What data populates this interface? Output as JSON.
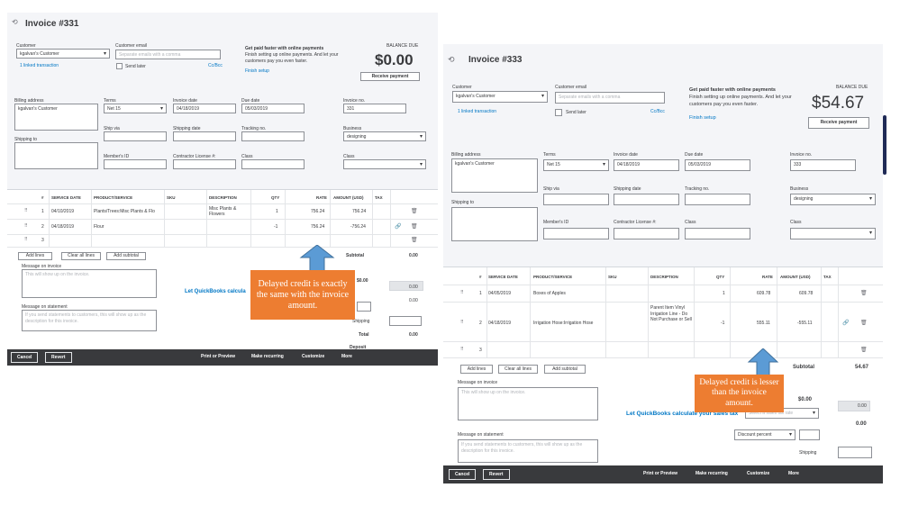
{
  "colors": {
    "callout": "#ed7d31",
    "arrow": "#5b9bd5",
    "link": "#0077c5",
    "footer": "#393a3d"
  },
  "left": {
    "title": "Invoice #331",
    "customer_label": "Customer",
    "customer_value": "kgalvan's Customer",
    "linked_transaction": "1 linked transaction",
    "email_label": "Customer email",
    "email_placeholder": "Separate emails with a comma",
    "send_later": "Send later",
    "cc_bcc": "Cc/Bcc",
    "online_title": "Get paid faster with online payments",
    "online_text": "Finish setting up online payments. And let your customers pay you even faster.",
    "finish_setup": "Finish setup",
    "balance_label": "BALANCE DUE",
    "balance_value": "$0.00",
    "receive_payment": "Receive payment",
    "billing_label": "Billing address",
    "billing_value": "kgalvan's Customer",
    "shipping_label": "Shipping to",
    "terms_label": "Terms",
    "terms_value": "Net 15",
    "invoice_date_label": "Invoice date",
    "invoice_date_value": "04/18/2019",
    "due_date_label": "Due date",
    "due_date_value": "05/03/2019",
    "invoice_no_label": "Invoice no.",
    "invoice_no_value": "331",
    "ship_via_label": "Ship via",
    "shipping_date_label": "Shipping date",
    "tracking_label": "Tracking no.",
    "business_label": "Business",
    "business_value": "designing",
    "members_label": "Member's ID",
    "contractor_label": "Contractor License #:",
    "class_label": "Class",
    "class2_label": "Class",
    "headers": [
      "#",
      "SERVICE DATE",
      "PRODUCT/SERVICE",
      "SKU",
      "DESCRIPTION",
      "QTY",
      "RATE",
      "AMOUNT (USD)",
      "TAX"
    ],
    "rows": [
      {
        "num": "1",
        "date": "04/10/2019",
        "product": "Plants/Trees:Misc Plants & Flo",
        "desc": "Misc Plants & Flowers",
        "qty": "1",
        "rate": "756.24",
        "amount": "756.24"
      },
      {
        "num": "2",
        "date": "04/18/2019",
        "product": "Flour",
        "desc": "",
        "qty": "-1",
        "rate": "756.24",
        "amount": "-756.24"
      },
      {
        "num": "3",
        "date": "",
        "product": "",
        "desc": "",
        "qty": "",
        "rate": "",
        "amount": ""
      }
    ],
    "add_lines": "Add lines",
    "clear_lines": "Clear all lines",
    "add_subtotal": "Add subtotal",
    "subtotal_label": "Subtotal",
    "subtotal_value": "0.00",
    "message_invoice_label": "Message on invoice",
    "message_invoice_placeholder": "This will show up on the invoice.",
    "message_statement_label": "Message on statement",
    "message_statement_placeholder": "If you send statements to customers, this will show up as the description for this invoice.",
    "quickbooks_link": "Let QuickBooks calcula",
    "tax_value": "$0.00",
    "tax_value2": "0.00",
    "tax_value3": "0.00",
    "shipping_label2": "Shipping",
    "total_label": "Total",
    "total_value": "0.00",
    "deposit_label": "Deposit",
    "cancel": "Cancel",
    "revert": "Revert",
    "print_preview": "Print or Preview",
    "make_recurring": "Make recurring",
    "customize": "Customize",
    "more": "More",
    "callout": "Delayed credit is exactly the same with the invoice amount."
  },
  "right": {
    "title": "Invoice #333",
    "customer_label": "Customer",
    "customer_value": "kgalvan's Customer",
    "linked_transaction": "1 linked transaction",
    "email_label": "Customer email",
    "email_placeholder": "Separate emails with a comma",
    "send_later": "Send later",
    "cc_bcc": "Cc/Bcc",
    "online_title": "Get paid faster with online payments",
    "online_text": "Finish setting up online payments. And let your customers pay you even faster.",
    "finish_setup": "Finish setup",
    "balance_label": "BALANCE DUE",
    "balance_value": "$54.67",
    "receive_payment": "Receive payment",
    "billing_label": "Billing address",
    "billing_value": "kgalvan's Customer",
    "shipping_label": "Shipping to",
    "terms_label": "Terms",
    "terms_value": "Net 15",
    "invoice_date_label": "Invoice date",
    "invoice_date_value": "04/18/2019",
    "due_date_label": "Due date",
    "due_date_value": "05/03/2019",
    "invoice_no_label": "Invoice no.",
    "invoice_no_value": "333",
    "ship_via_label": "Ship via",
    "shipping_date_label": "Shipping date",
    "tracking_label": "Tracking no.",
    "business_label": "Business",
    "business_value": "designing",
    "members_label": "Member's ID",
    "contractor_label": "Contractor License #:",
    "class_label": "Class",
    "class2_label": "Class",
    "headers": [
      "#",
      "SERVICE DATE",
      "PRODUCT/SERVICE",
      "SKU",
      "DESCRIPTION",
      "QTY",
      "RATE",
      "AMOUNT (USD)",
      "TAX"
    ],
    "rows": [
      {
        "num": "1",
        "date": "04/05/2019",
        "product": "Boxes of Apples",
        "desc": "",
        "qty": "1",
        "rate": "609.78",
        "amount": "609.78"
      },
      {
        "num": "2",
        "date": "04/18/2019",
        "product": "Irrigation Hose:Irrigation Hose",
        "desc": "Parent Item Vinyl Irrigation Line - Do Not Purchase or Sell",
        "qty": "-1",
        "rate": "555.11",
        "amount": "-555.11"
      },
      {
        "num": "3",
        "date": "",
        "product": "",
        "desc": "",
        "qty": "",
        "rate": "",
        "amount": ""
      }
    ],
    "add_lines": "Add lines",
    "clear_lines": "Clear all lines",
    "add_subtotal": "Add subtotal",
    "subtotal_label": "Subtotal",
    "subtotal_value": "54.67",
    "message_invoice_label": "Message on invoice",
    "message_invoice_placeholder": "This will show up on the invoice.",
    "message_statement_label": "Message on statement",
    "message_statement_placeholder": "If you send statements to customers, this will show up as the description for this invoice.",
    "quickbooks_link": "Let QuickBooks calculate your sales tax",
    "tax_value": "$0.00",
    "tax_value2": "0.00",
    "tax_value3": "0.00",
    "select_rate_placeholder": "Select a sales tax rate",
    "discount_label": "Discount percent",
    "shipping_label2": "Shipping",
    "cancel": "Cancel",
    "revert": "Revert",
    "print_preview": "Print or Preview",
    "make_recurring": "Make recurring",
    "customize": "Customize",
    "more": "More",
    "callout": "Delayed credit is lesser than the invoice amount."
  }
}
